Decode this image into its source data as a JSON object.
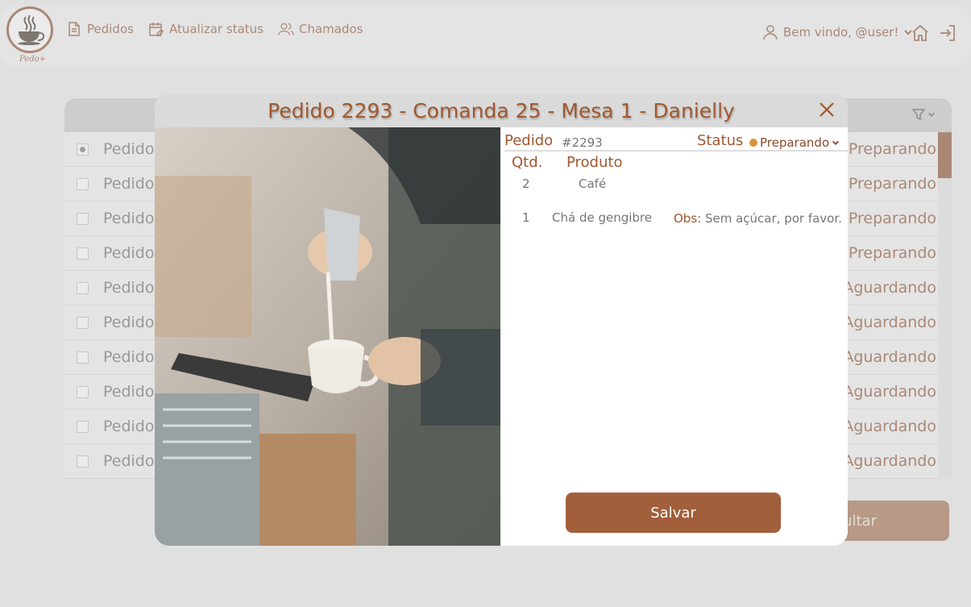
{
  "header": {
    "logo_text": "Pedo+",
    "nav": [
      {
        "label": "Pedidos",
        "icon": "document-icon"
      },
      {
        "label": "Atualizar status",
        "icon": "calendar-edit-icon"
      },
      {
        "label": "Chamados",
        "icon": "users-icon"
      }
    ],
    "welcome": "Bem vindo, @user!"
  },
  "table": {
    "rows": [
      {
        "label": "Pedido",
        "status": "Preparando",
        "checked": true
      },
      {
        "label": "Pedido",
        "status": "Preparando",
        "checked": false
      },
      {
        "label": "Pedido",
        "status": "Preparando",
        "checked": false
      },
      {
        "label": "Pedido",
        "status": "Preparando",
        "checked": false
      },
      {
        "label": "Pedido",
        "status": "Aguardando",
        "checked": false
      },
      {
        "label": "Pedido",
        "status": "Aguardando",
        "checked": false
      },
      {
        "label": "Pedido",
        "status": "Aguardando",
        "checked": false
      },
      {
        "label": "Pedido",
        "status": "Aguardando",
        "checked": false
      },
      {
        "label": "Pedido",
        "status": "Aguardando",
        "checked": false
      },
      {
        "label": "Pedido",
        "status": "Aguardando",
        "checked": false
      }
    ],
    "action_button_partial": "ultar"
  },
  "modal": {
    "title": "Pedido 2293 - Comanda 25 - Mesa 1 - Danielly",
    "pedido_label": "Pedido",
    "pedido_value": "#2293",
    "status_label": "Status",
    "status_value": "Preparando",
    "col_qtd": "Qtd.",
    "col_produto": "Produto",
    "items": [
      {
        "qty": "2",
        "product": "Café",
        "obs_label": "",
        "obs": ""
      },
      {
        "qty": "1",
        "product": "Chá de gengibre",
        "obs_label": "Obs:",
        "obs": "Sem açúcar, por favor."
      }
    ],
    "save_label": "Salvar"
  },
  "colors": {
    "brand": "#8a4b2a",
    "accent": "#a25f3b",
    "status_dot": "#d9913a"
  }
}
